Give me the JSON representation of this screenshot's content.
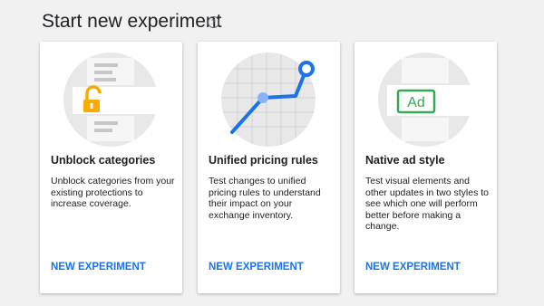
{
  "header": {
    "title": "Start new experiment",
    "help_icon": "help-circle-icon",
    "help_glyph": "?"
  },
  "cards": [
    {
      "title": "Unblock categories",
      "description": "Unblock categories from your existing protections to increase coverage.",
      "action": "NEW EXPERIMENT",
      "illustration": "unlocked-padlock-icon"
    },
    {
      "title": "Unified pricing rules",
      "description": "Test changes to unified pricing rules to understand their impact on your exchange inventory.",
      "action": "NEW EXPERIMENT",
      "illustration": "line-chart-icon"
    },
    {
      "title": "Native ad style",
      "description": "Test visual elements and other updates in two styles to see which one will perform better before making a change.",
      "action": "NEW EXPERIMENT",
      "illustration": "ad-badge-icon",
      "illustration_text": "Ad"
    }
  ],
  "colors": {
    "accent": "#1a73e8",
    "lock": "#f9ab00",
    "ad_badge": "#34a853",
    "chart_line": "#1a73e8",
    "chart_point": "#8ab4f8"
  }
}
